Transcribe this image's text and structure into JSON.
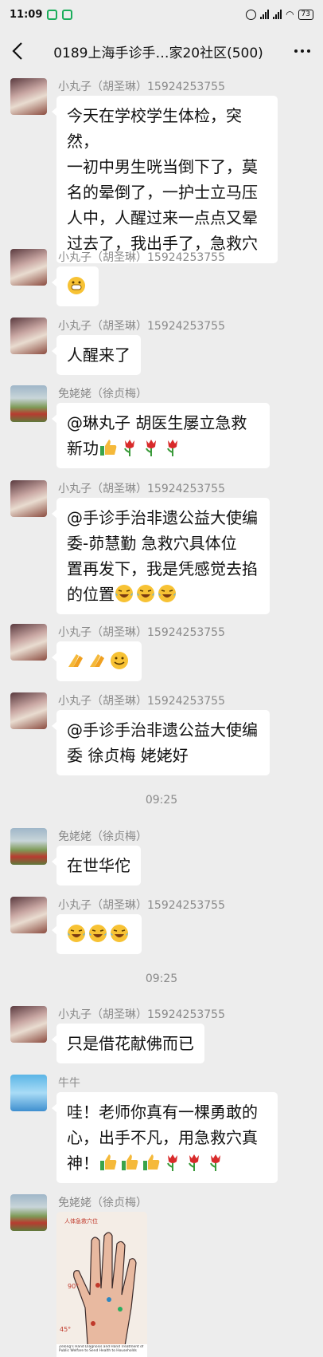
{
  "status": {
    "time": "11:09",
    "battery": "73"
  },
  "header": {
    "title": "0189上海手诊手…家20社区(500)"
  },
  "messages": [
    {
      "sender": "小丸子（胡圣琳）15924253755",
      "lines": [
        "今天在学校学生体检，突然，",
        "一初中男生咣当倒下了，莫",
        "名的晕倒了，一护士立马压",
        "人中，人醒过来一点点又晕",
        "过去了，我出手了，急救穴"
      ],
      "avatar": "girl-avatar"
    },
    {
      "sender": "小丸子（胡圣琳）15924253755",
      "lines": [],
      "emoji": [
        "grin-emoji"
      ],
      "avatar": "girl-avatar"
    },
    {
      "sender": "小丸子（胡圣琳）15924253755",
      "lines": [
        "人醒来了"
      ],
      "avatar": "girl-avatar"
    },
    {
      "sender": "免姥姥（徐贞梅）",
      "lines": [
        "@琳丸子  胡医生屡立急救",
        "新功"
      ],
      "emoji": [
        "thumbs-up-emoji",
        "tulip-emoji",
        "tulip-emoji",
        "tulip-emoji"
      ],
      "avatar": "grass-avatar"
    },
    {
      "sender": "小丸子（胡圣琳）15924253755",
      "lines": [
        "@手诊手治非遗公益大使编",
        "委-茆慧勤  急救穴具体位",
        "置再发下，我是凭感觉去掐",
        "的位置"
      ],
      "emoji": [
        "laughing-crying-emoji",
        "laughing-crying-emoji",
        "laughing-crying-emoji"
      ],
      "avatar": "girl-avatar"
    },
    {
      "sender": "小丸子（胡圣琳）15924253755",
      "lines": [],
      "emoji": [
        "clap-emoji",
        "clap-emoji",
        "smile-emoji"
      ],
      "avatar": "girl-avatar"
    },
    {
      "sender": "小丸子（胡圣琳）15924253755",
      "lines": [
        "@手诊手治非遗公益大使编",
        "委 徐贞梅  姥姥好"
      ],
      "avatar": "girl-avatar"
    },
    {
      "sender": "免姥姥（徐贞梅）",
      "lines": [
        "在世华佗"
      ],
      "avatar": "grass-avatar"
    },
    {
      "sender": "小丸子（胡圣琳）15924253755",
      "lines": [],
      "emoji": [
        "laughing-crying-emoji",
        "laughing-crying-emoji",
        "laughing-crying-emoji"
      ],
      "avatar": "girl-avatar"
    },
    {
      "sender": "小丸子（胡圣琳）15924253755",
      "lines": [
        "只是借花献佛而已"
      ],
      "avatar": "girl-avatar"
    },
    {
      "sender": "牛牛",
      "lines": [
        "哇！老师你真有一棵勇敢的",
        "心，出手不凡，用急救穴真",
        "神！"
      ],
      "emoji": [
        "thumbs-up-emoji",
        "thumbs-up-emoji",
        "thumbs-up-emoji",
        "tulip-emoji",
        "tulip-emoji",
        "tulip-emoji"
      ],
      "avatar": "cartoon-avatar"
    },
    {
      "sender": "免姥姥（徐贞梅）",
      "lines": [],
      "image": {
        "top_label": "人体急救穴位",
        "angle_1": "90°",
        "angle_2": "45°",
        "caption": "Zelong's Hand Diagnosis and Hand Treatment of Public Welfare to Send Health to Households"
      },
      "avatar": "grass-avatar"
    }
  ],
  "timestamps": [
    "09:25",
    "09:25"
  ],
  "colors": {
    "background": "#ededed",
    "bubble": "#ffffff",
    "meta": "#8a8a8a"
  }
}
